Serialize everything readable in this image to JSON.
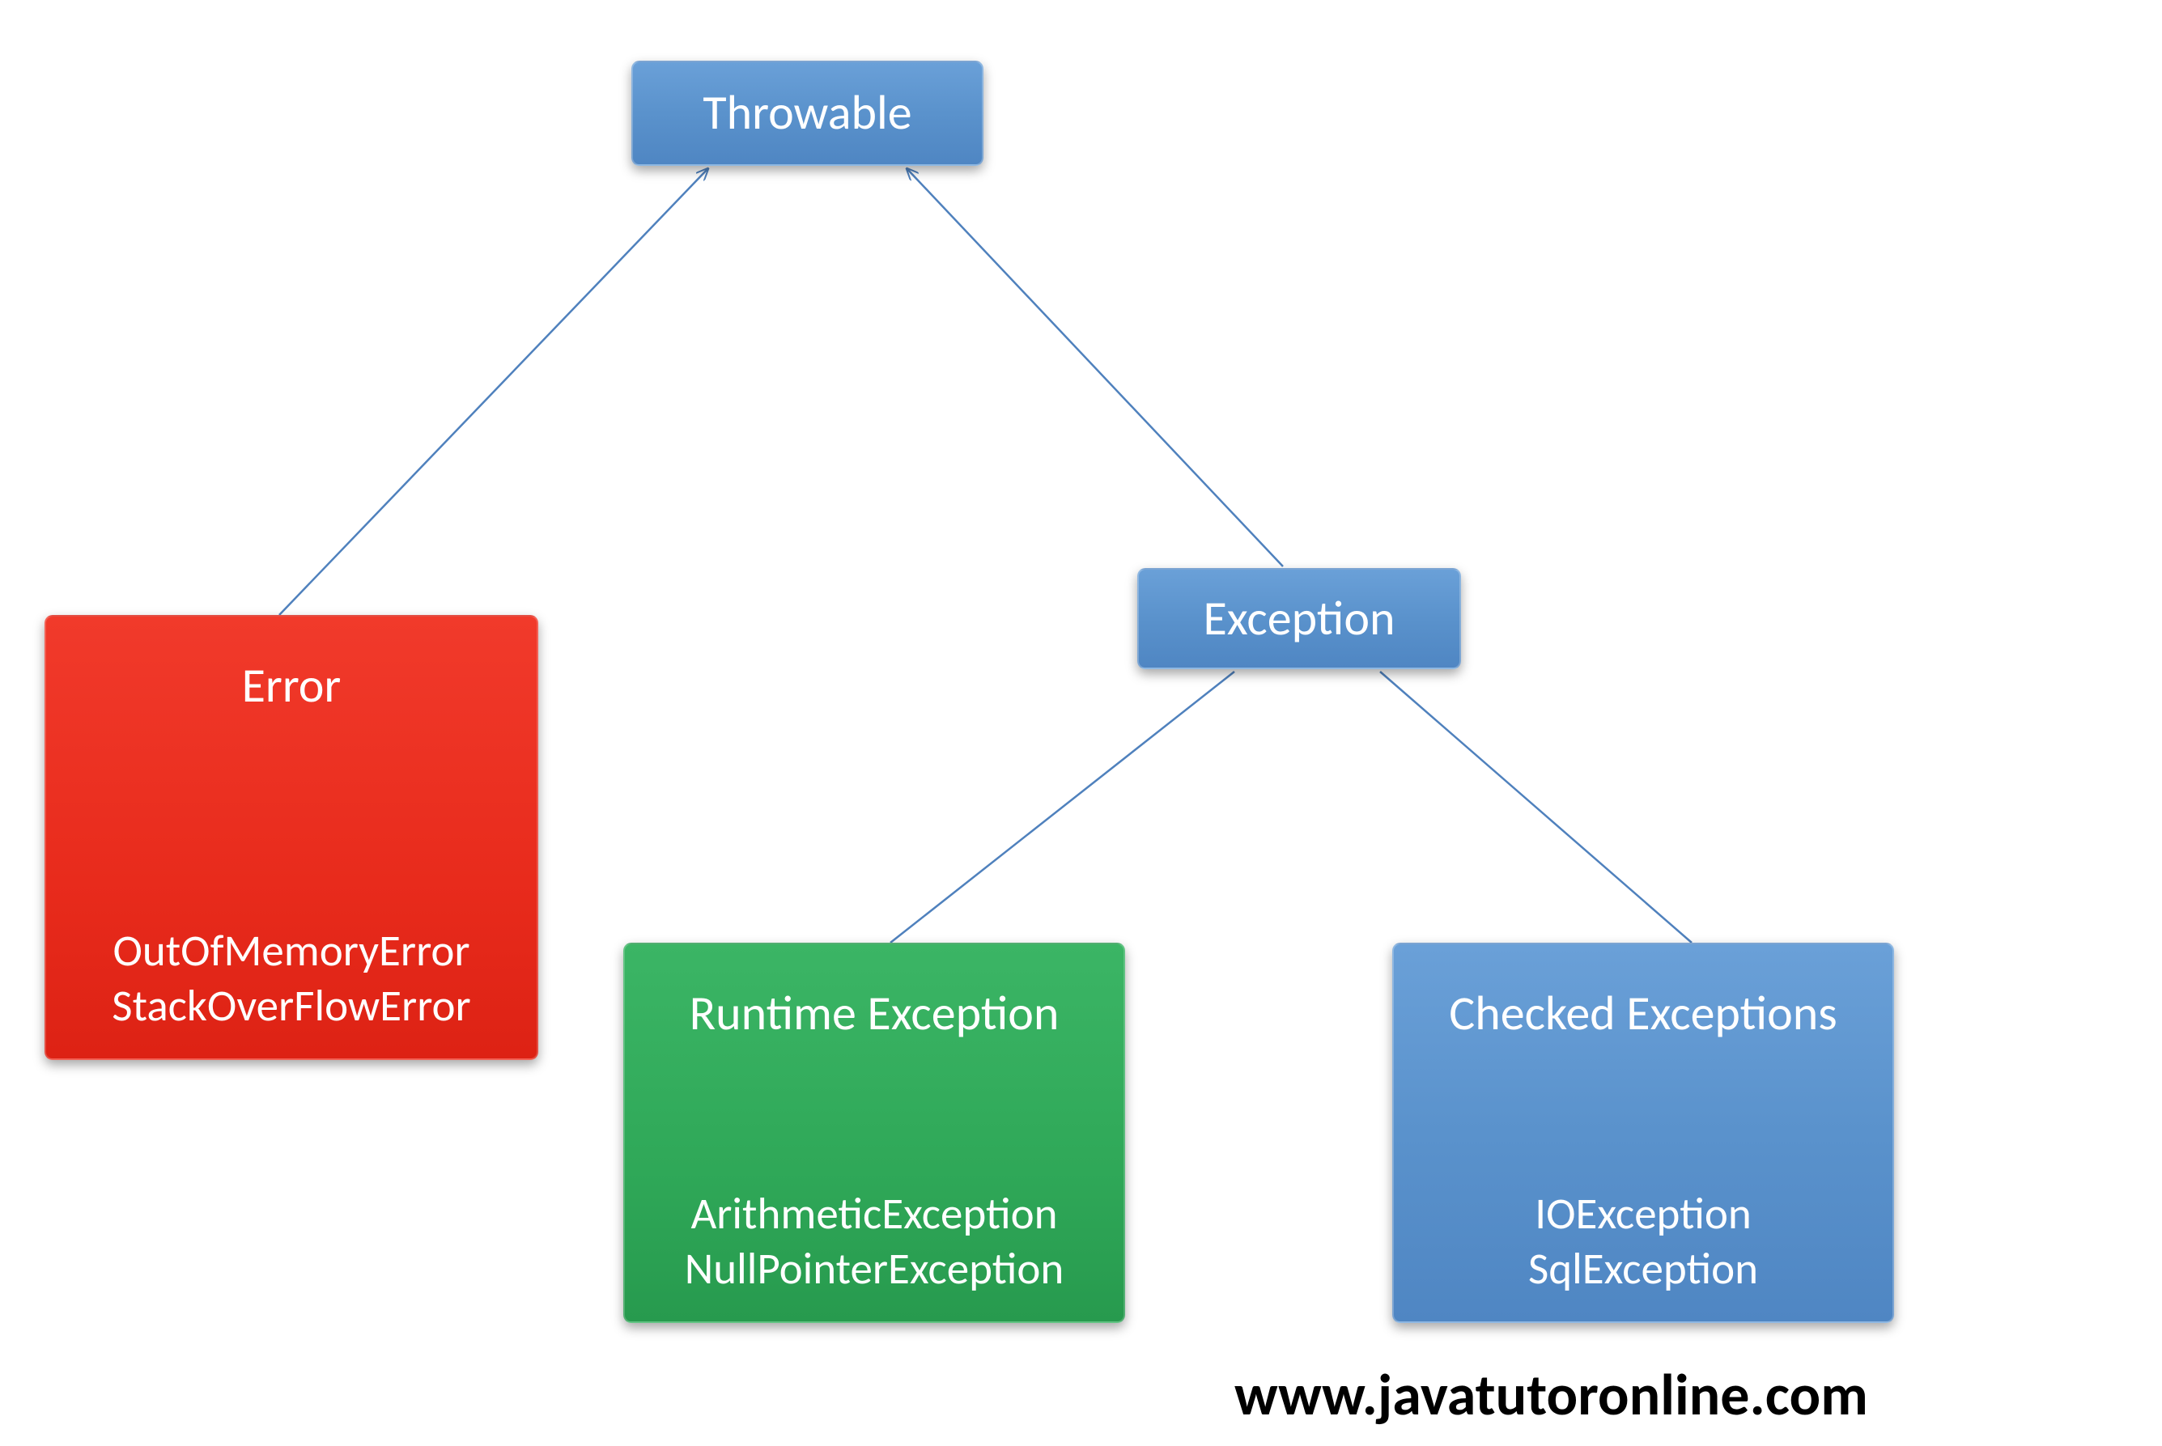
{
  "nodes": {
    "root": {
      "label": "Throwable"
    },
    "error": {
      "title": "Error",
      "examples": "OutOfMemoryError\nStackOverFlowError"
    },
    "exception": {
      "label": "Exception"
    },
    "runtime": {
      "title": "Runtime Exception",
      "examples": "ArithmeticException\nNullPointerException"
    },
    "checked": {
      "title": "Checked Exceptions",
      "examples": "IOException\nSqlException"
    }
  },
  "watermark": "www.javatutoronline.com",
  "colors": {
    "blue": "#5a92cc",
    "red": "#e82b1c",
    "green": "#2fa858"
  }
}
